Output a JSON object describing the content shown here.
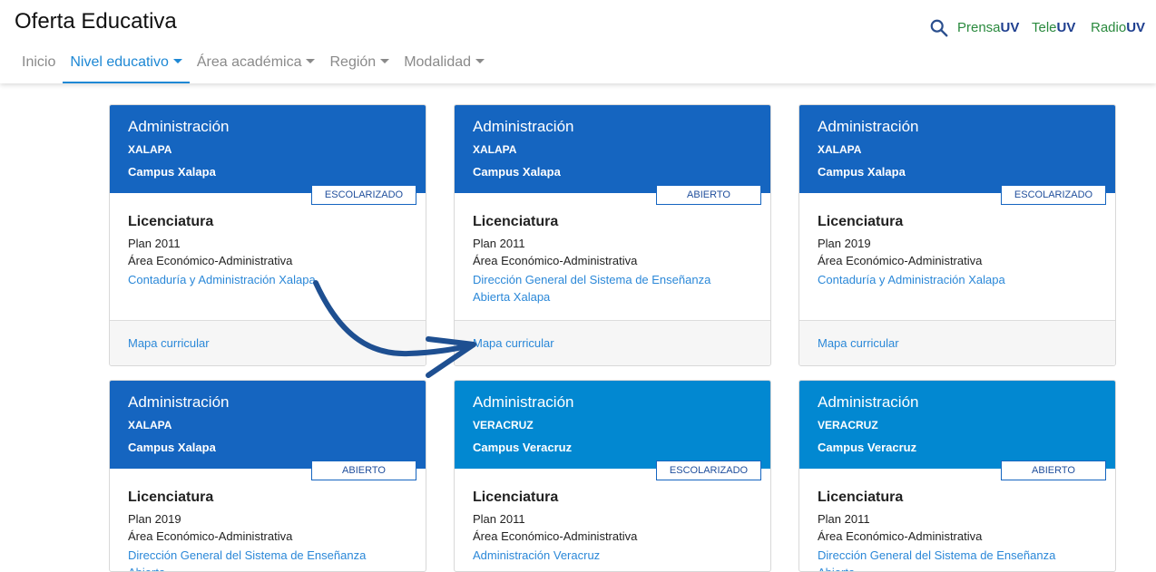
{
  "header": {
    "title": "Oferta Educativa",
    "brands": [
      {
        "word": "Prensa",
        "suffix": "UV"
      },
      {
        "word": "Tele",
        "suffix": "UV"
      },
      {
        "word": "Radio",
        "suffix": "UV"
      }
    ]
  },
  "nav": [
    {
      "label": "Inicio"
    },
    {
      "label": "Nivel educativo"
    },
    {
      "label": "Área académica"
    },
    {
      "label": "Región"
    },
    {
      "label": "Modalidad"
    }
  ],
  "colors": {
    "dark_blue": "#1565c0",
    "light_blue": "#0288d1",
    "link": "#2b88d8"
  },
  "cards": [
    {
      "title": "Administración",
      "region": "XALAPA",
      "campus": "Campus Xalapa",
      "badge": "ESCOLARIZADO",
      "level": "Licenciatura",
      "plan": "Plan 2011",
      "area": "Área Económico-Administrativa",
      "entity": "Contaduría y Administración Xalapa",
      "footer_link": "Mapa curricular"
    },
    {
      "title": "Administración",
      "region": "XALAPA",
      "campus": "Campus Xalapa",
      "badge": "ABIERTO",
      "level": "Licenciatura",
      "plan": "Plan 2011",
      "area": "Área Económico-Administrativa",
      "entity": "Dirección General del Sistema de Enseñanza Abierta Xalapa",
      "footer_link": "Mapa curricular"
    },
    {
      "title": "Administración",
      "region": "XALAPA",
      "campus": "Campus Xalapa",
      "badge": "ESCOLARIZADO",
      "level": "Licenciatura",
      "plan": "Plan 2019",
      "area": "Área Económico-Administrativa",
      "entity": "Contaduría y Administración Xalapa",
      "footer_link": "Mapa curricular"
    },
    {
      "title": "Administración",
      "region": "XALAPA",
      "campus": "Campus Xalapa",
      "badge": "ABIERTO",
      "level": "Licenciatura",
      "plan": "Plan 2019",
      "area": "Área Económico-Administrativa",
      "entity": "Dirección General del Sistema de Enseñanza Abierta"
    },
    {
      "title": "Administración",
      "region": "VERACRUZ",
      "campus": "Campus Veracruz",
      "badge": "ESCOLARIZADO",
      "level": "Licenciatura",
      "plan": "Plan 2011",
      "area": "Área Económico-Administrativa",
      "entity": "Administración Veracruz"
    },
    {
      "title": "Administración",
      "region": "VERACRUZ",
      "campus": "Campus Veracruz",
      "badge": "ABIERTO",
      "level": "Licenciatura",
      "plan": "Plan 2011",
      "area": "Área Económico-Administrativa",
      "entity": "Dirección General del Sistema de Enseñanza Abierta"
    }
  ]
}
